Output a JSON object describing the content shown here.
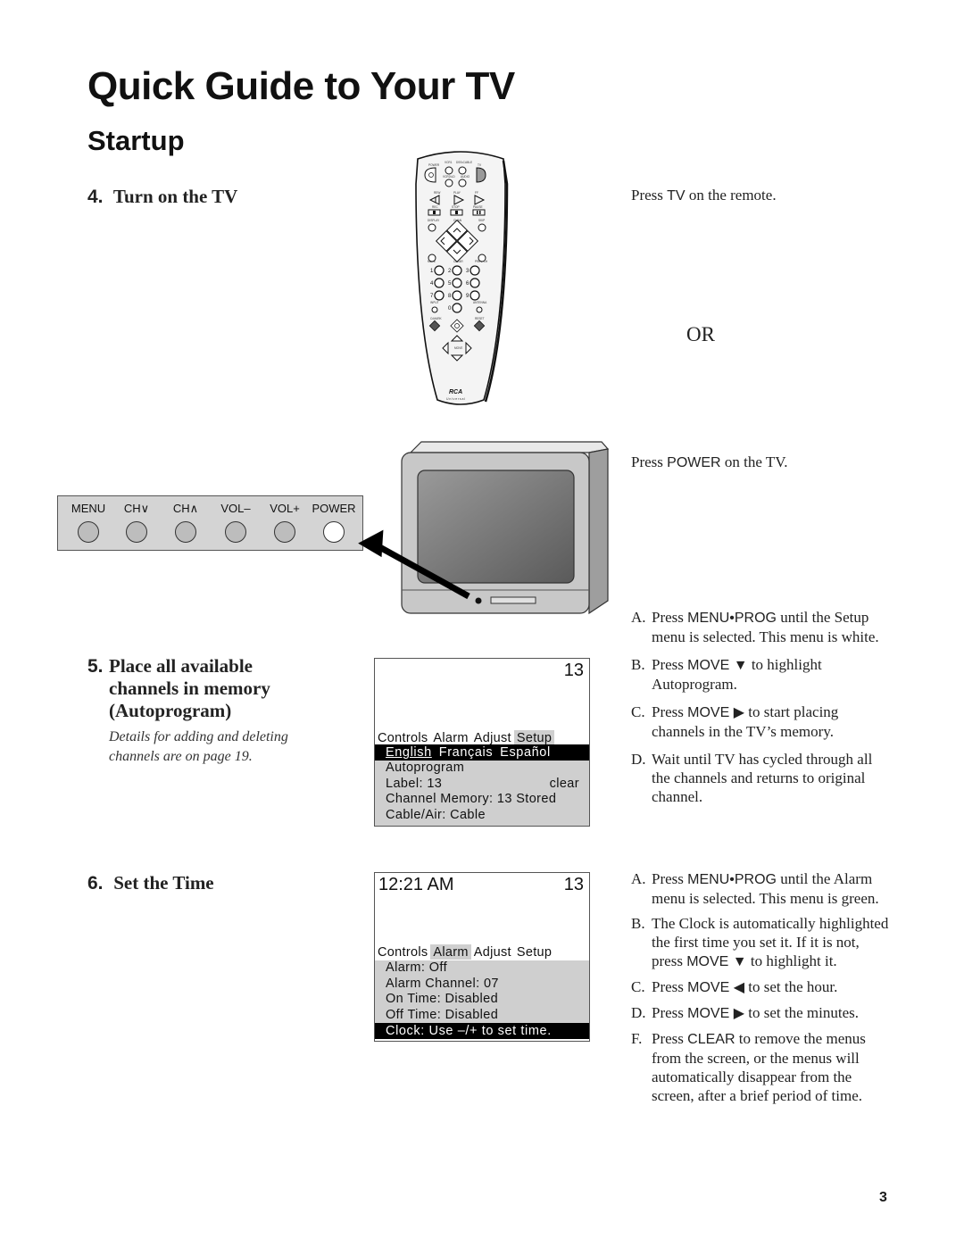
{
  "page": {
    "title": "Quick Guide to Your TV",
    "section": "Startup",
    "page_number": "3"
  },
  "step4": {
    "number": "4.",
    "title": "Turn on the TV",
    "press_tv_pre": "Press ",
    "press_tv_key": "TV",
    "press_tv_post": " on the remote.",
    "or": "OR",
    "press_power_pre": "Press ",
    "press_power_key": "POWER",
    "press_power_post": " on the TV."
  },
  "remote": {
    "brand": "RCA",
    "sub_brand": "Universal",
    "labels": {
      "power": "POWER",
      "vcr1": "VCR1",
      "dss_cable": "DSS•CABLE",
      "tv": "TV",
      "vcr2_ld": "VCR2•LD",
      "audio": "AUDIO",
      "rew": "REW",
      "play": "PLAY",
      "ff": "FF",
      "rec": "REC",
      "stop": "STOP",
      "pause": "PAUSE",
      "display": "DISPLAY",
      "skip": "SKIP",
      "chan": "CHAN",
      "vol": "VOL",
      "mute": "MUTE",
      "clear": "CLEAR",
      "prev_ch": "PREV CH",
      "input": "INPUT",
      "antenna": "ANTENNA",
      "cmark": "C•MARK",
      "menu_prog": "MENU•PROG",
      "reset": "RESET",
      "move": "MOVE",
      "digits": [
        "1",
        "2",
        "3",
        "4",
        "5",
        "6",
        "7",
        "8",
        "9",
        "0"
      ]
    }
  },
  "front_panel": {
    "buttons": [
      {
        "label": "MENU"
      },
      {
        "label": "CH∨"
      },
      {
        "label": "CH∧"
      },
      {
        "label": "VOL–"
      },
      {
        "label": "VOL+"
      },
      {
        "label": "POWER"
      }
    ]
  },
  "step5": {
    "number": "5.",
    "title_lines": [
      "Place all available",
      "channels in memory",
      "(Autoprogram)"
    ],
    "note_lines": [
      "Details for adding and deleting",
      "channels are on page 19."
    ],
    "instructions": [
      {
        "label": "A.",
        "parts": [
          {
            "t": "Press "
          },
          {
            "k": "MENU•PROG"
          },
          {
            "t": " until the Setup menu is selected. This menu is white."
          }
        ]
      },
      {
        "label": "B.",
        "parts": [
          {
            "t": "Press "
          },
          {
            "k": "MOVE ▼"
          },
          {
            "t": " to highlight Autoprogram."
          }
        ]
      },
      {
        "label": "C.",
        "parts": [
          {
            "t": "Press "
          },
          {
            "k": "MOVE ▶"
          },
          {
            "t": " to start placing channels in the TV’s memory."
          }
        ]
      },
      {
        "label": "D.",
        "parts": [
          {
            "t": "Wait until TV has cycled through all the channels and returns to original channel."
          }
        ]
      }
    ],
    "screen": {
      "channel": "13",
      "tabs": [
        "Controls",
        "Alarm",
        "Adjust",
        "Setup"
      ],
      "selected_tab": "Setup",
      "languages": [
        "English",
        "Français",
        "Español"
      ],
      "selected_language": "English",
      "rows": [
        {
          "text": "Autoprogram",
          "right": ""
        },
        {
          "text": "Label: 13",
          "right": "clear"
        },
        {
          "text": "Channel Memory: 13 Stored",
          "right": ""
        },
        {
          "text": "Cable/Air: Cable",
          "right": ""
        }
      ]
    }
  },
  "step6": {
    "number": "6.",
    "title": "Set the Time",
    "instructions": [
      {
        "label": "A.",
        "parts": [
          {
            "t": "Press "
          },
          {
            "k": "MENU•PROG"
          },
          {
            "t": " until the Alarm menu is selected.  This menu is green."
          }
        ]
      },
      {
        "label": "B.",
        "parts": [
          {
            "t": "The Clock is automatically highlighted the first time you set it.  If it is not, press "
          },
          {
            "k": "MOVE ▼"
          },
          {
            "t": " to highlight it."
          }
        ]
      },
      {
        "label": "C.",
        "parts": [
          {
            "t": "Press "
          },
          {
            "k": "MOVE ◀"
          },
          {
            "t": " to set the hour."
          }
        ]
      },
      {
        "label": "D.",
        "parts": [
          {
            "t": "Press "
          },
          {
            "k": "MOVE ▶"
          },
          {
            "t": " to set the minutes."
          }
        ]
      },
      {
        "label": "F.",
        "parts": [
          {
            "t": "Press "
          },
          {
            "k": "CLEAR"
          },
          {
            "t": " to remove the menus from the screen, or the menus will automatically disappear from the screen, after a brief period of time."
          }
        ]
      }
    ],
    "screen": {
      "clock": "12:21 AM",
      "channel": "13",
      "tabs": [
        "Controls",
        "Alarm",
        "Adjust",
        "Setup"
      ],
      "selected_tab": "Alarm",
      "rows": [
        {
          "text": "Alarm: Off"
        },
        {
          "text": "Alarm Channel:  07"
        },
        {
          "text": "On Time:  Disabled"
        },
        {
          "text": "Off Time:  Disabled"
        }
      ],
      "highlight_row": "Clock:  Use –/+ to set time."
    }
  }
}
